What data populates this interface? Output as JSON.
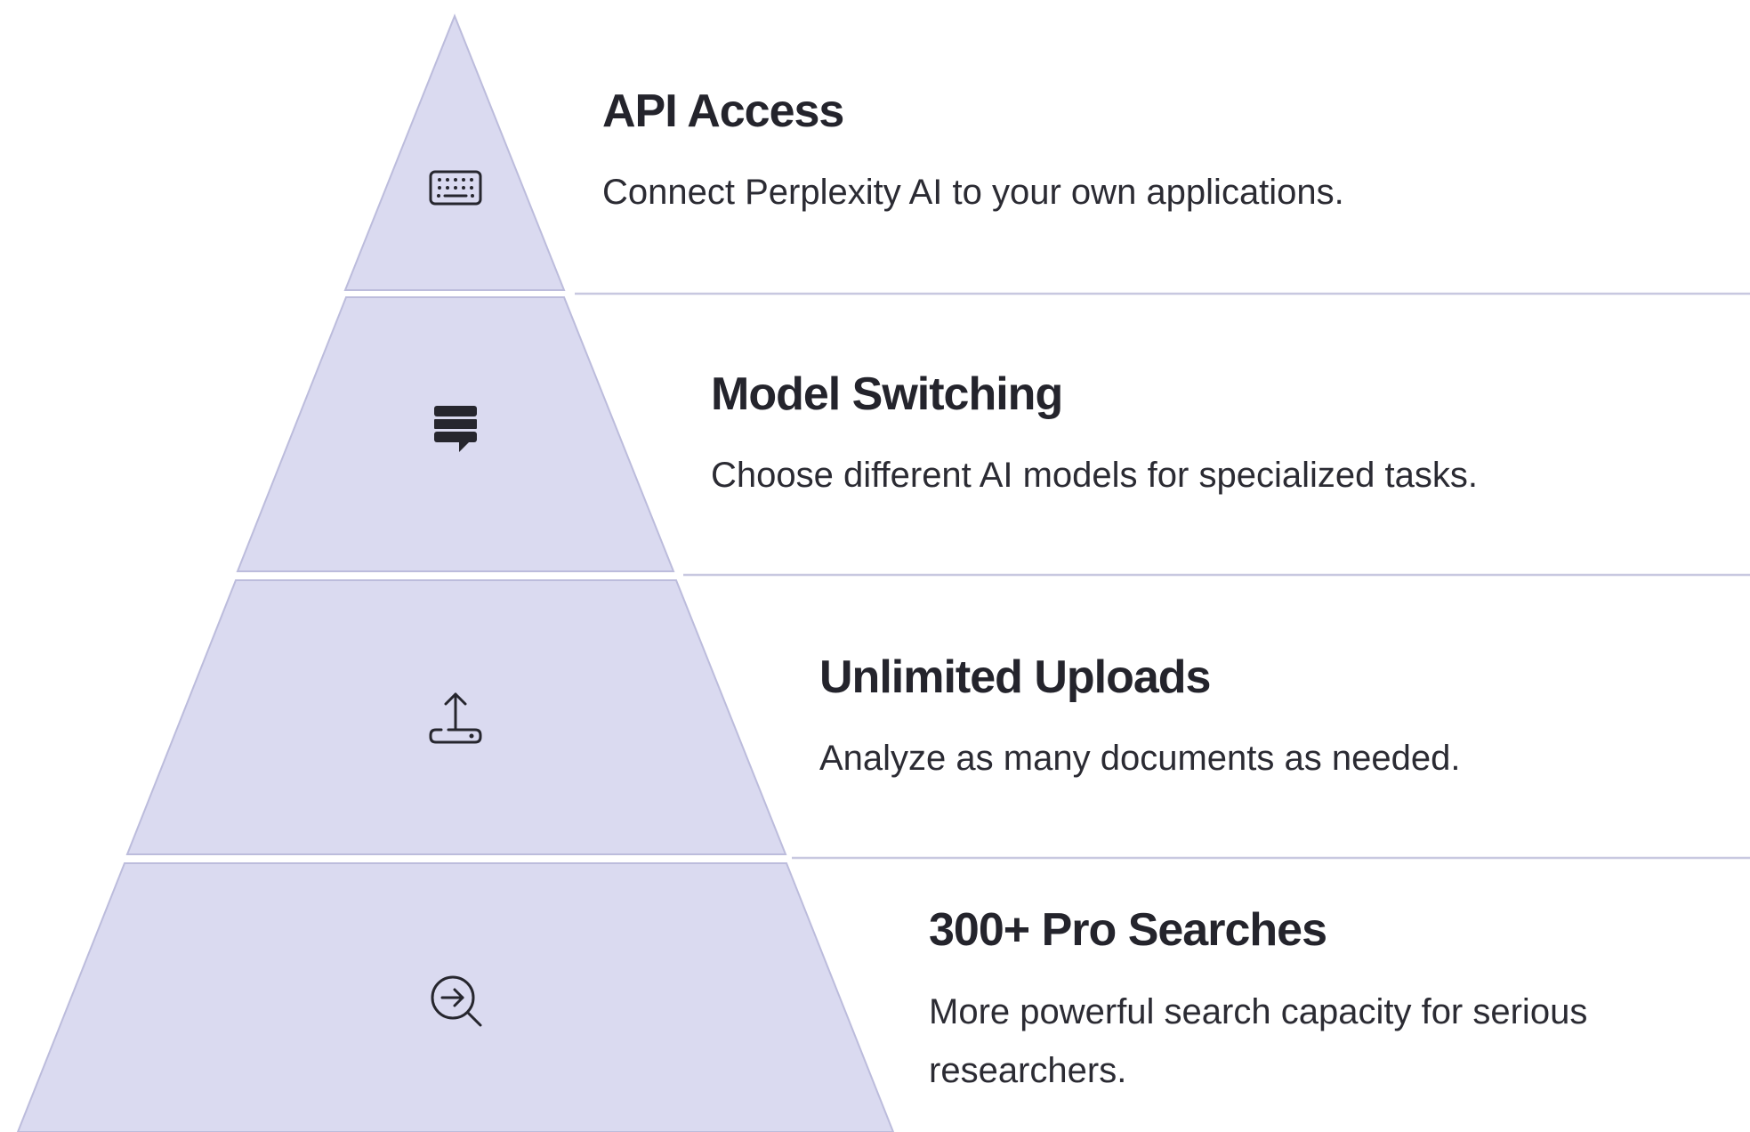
{
  "diagram": {
    "type": "pyramid",
    "colors": {
      "tier_fill": "#dadaf0",
      "tier_stroke": "#bcbcdc",
      "separator": "#c8c8e0",
      "title": "#24242c",
      "text": "#2b2b33"
    },
    "tiers": [
      {
        "title": "API Access",
        "description_lines": [
          "Connect Perplexity AI to your own applications."
        ],
        "icon": "keyboard-icon"
      },
      {
        "title": "Model Switching",
        "description_lines": [
          "Choose different AI models for specialized tasks."
        ],
        "icon": "stacked-chat-icon"
      },
      {
        "title": "Unlimited Uploads",
        "description_lines": [
          "Analyze as many documents as needed."
        ],
        "icon": "upload-icon"
      },
      {
        "title": "300+ Pro Searches",
        "description_lines": [
          "More powerful search capacity for serious",
          "researchers."
        ],
        "icon": "search-arrow-icon"
      }
    ]
  }
}
